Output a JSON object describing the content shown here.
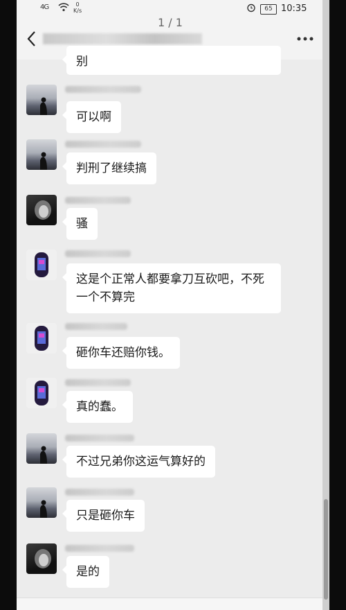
{
  "status_bar": {
    "signal": "4G",
    "speed_value": "0",
    "speed_unit": "K/s",
    "battery": "65",
    "time": "10:35"
  },
  "header": {
    "page_counter": "1 / 1",
    "chat_title": "",
    "back_icon": "back-arrow-icon",
    "more_icon": "more-dots-icon"
  },
  "messages": [
    {
      "text": "别",
      "avatar": "none"
    },
    {
      "text": "可以啊",
      "avatar": "sunset-silhouette"
    },
    {
      "text": "判刑了继续搞",
      "avatar": "sunset-silhouette"
    },
    {
      "text": "骚",
      "avatar": "dark-portrait"
    },
    {
      "text": "这是个正常人都要拿刀互砍吧，不死一个不算完",
      "avatar": "phone-purple"
    },
    {
      "text": "砸你车还赔你钱。",
      "avatar": "phone-purple"
    },
    {
      "text": "真的蠢。",
      "avatar": "phone-purple"
    },
    {
      "text": "不过兄弟你这运气算好的",
      "avatar": "sunset-silhouette"
    },
    {
      "text": "只是砸你车",
      "avatar": "sunset-silhouette"
    },
    {
      "text": "是的",
      "avatar": "dark-portrait"
    }
  ]
}
